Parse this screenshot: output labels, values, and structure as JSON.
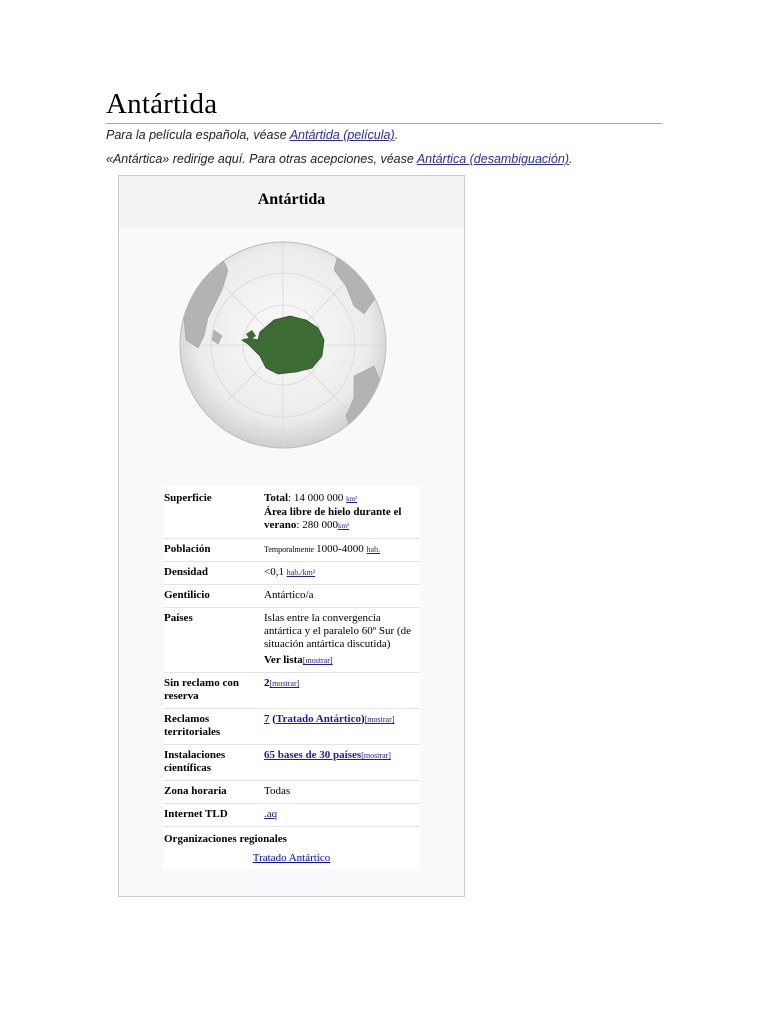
{
  "page": {
    "title": "Antártida",
    "hatnote1": {
      "prefix": "Para la película española, véase ",
      "link": "Antártida (película)",
      "suffix": "."
    },
    "hatnote2": {
      "prefix": "«Antártica» redirige aquí. Para otras acepciones, véase ",
      "link": "Antártica (desambiguación)",
      "suffix": "."
    }
  },
  "infobox": {
    "title": "Antártida",
    "map_image": "orthographic-globe-antarctica",
    "colors": {
      "land_highlight": "#3d6b34",
      "land_other": "#b5b5b5",
      "ocean": "#f2f2f2"
    },
    "rows": {
      "superficie": {
        "label": "Superficie",
        "total_label": "Total",
        "total_value": ": 14 000 000 ",
        "total_unit": "km²",
        "area_label": "Área libre de hielo durante el verano",
        "area_value": ": 280 000",
        "area_unit": "km²"
      },
      "poblacion": {
        "label": "Población",
        "prefix": "Temporalmente ",
        "value": "1000-4000 ",
        "unit": "hab."
      },
      "densidad": {
        "label": "Densidad",
        "value": "<0,1 ",
        "unit": "hab./km²"
      },
      "gentilicio": {
        "label": "Gentilicio",
        "value": "Antártico/a"
      },
      "paises": {
        "label": "Países",
        "value": "Islas entre la convergencia antártica y el paralelo 60º Sur (de situación antártica discutida)",
        "list_label": "Ver lista",
        "toggle": "[mostrar]"
      },
      "sin_reclamo": {
        "label": "Sin reclamo con reserva",
        "value": "2",
        "toggle": "[mostrar]"
      },
      "reclamos": {
        "label": "Reclamos territoriales",
        "count": "7",
        "open": " (",
        "link": "Tratado Antártico",
        "close": ")",
        "toggle": "[mostrar]"
      },
      "instalaciones": {
        "label": "Instalaciones científicas",
        "link": "65 bases de 30 países",
        "toggle": "[mostrar]"
      },
      "zona": {
        "label": "Zona horaria",
        "value": "Todas"
      },
      "tld": {
        "label": "Internet TLD",
        "value": ".aq"
      }
    },
    "organizaciones": {
      "label": "Organizaciones regionales",
      "link": "Tratado Antártico"
    }
  }
}
